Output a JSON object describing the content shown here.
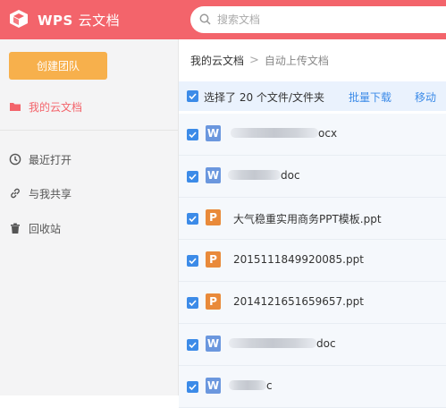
{
  "header": {
    "brand": "WPS",
    "brand_sub": "云文档",
    "search_placeholder": "搜索文档",
    "colors": {
      "bg": "#f3646b"
    }
  },
  "sidebar": {
    "create_team_label": "创建团队",
    "items": [
      {
        "label": "我的云文档",
        "icon": "folder-icon",
        "active": true
      },
      {
        "label": "最近打开",
        "icon": "clock-icon",
        "active": false
      },
      {
        "label": "与我共享",
        "icon": "link-icon",
        "active": false
      },
      {
        "label": "回收站",
        "icon": "trash-icon",
        "active": false
      }
    ]
  },
  "breadcrumb": {
    "root": "我的云文档",
    "separator": ">",
    "current": "自动上传文档"
  },
  "selection": {
    "text": "选择了 20 个文件/文件夹",
    "batch_download": "批量下载",
    "move": "移动"
  },
  "files": [
    {
      "type": "doc",
      "icon_letter": "W",
      "name_visible": "ocx",
      "checked": true
    },
    {
      "type": "doc",
      "icon_letter": "W",
      "name_visible": "doc",
      "checked": true
    },
    {
      "type": "ppt",
      "icon_letter": "P",
      "name_visible": "大气稳重实用商务PPT模板.ppt",
      "checked": true
    },
    {
      "type": "ppt",
      "icon_letter": "P",
      "name_visible": "2015111849920085.ppt",
      "checked": true
    },
    {
      "type": "ppt",
      "icon_letter": "P",
      "name_visible": "2014121651659657.ppt",
      "checked": true
    },
    {
      "type": "doc",
      "icon_letter": "W",
      "name_visible": "doc",
      "checked": true
    },
    {
      "type": "doc",
      "icon_letter": "W",
      "name_visible": "c",
      "checked": true
    }
  ]
}
